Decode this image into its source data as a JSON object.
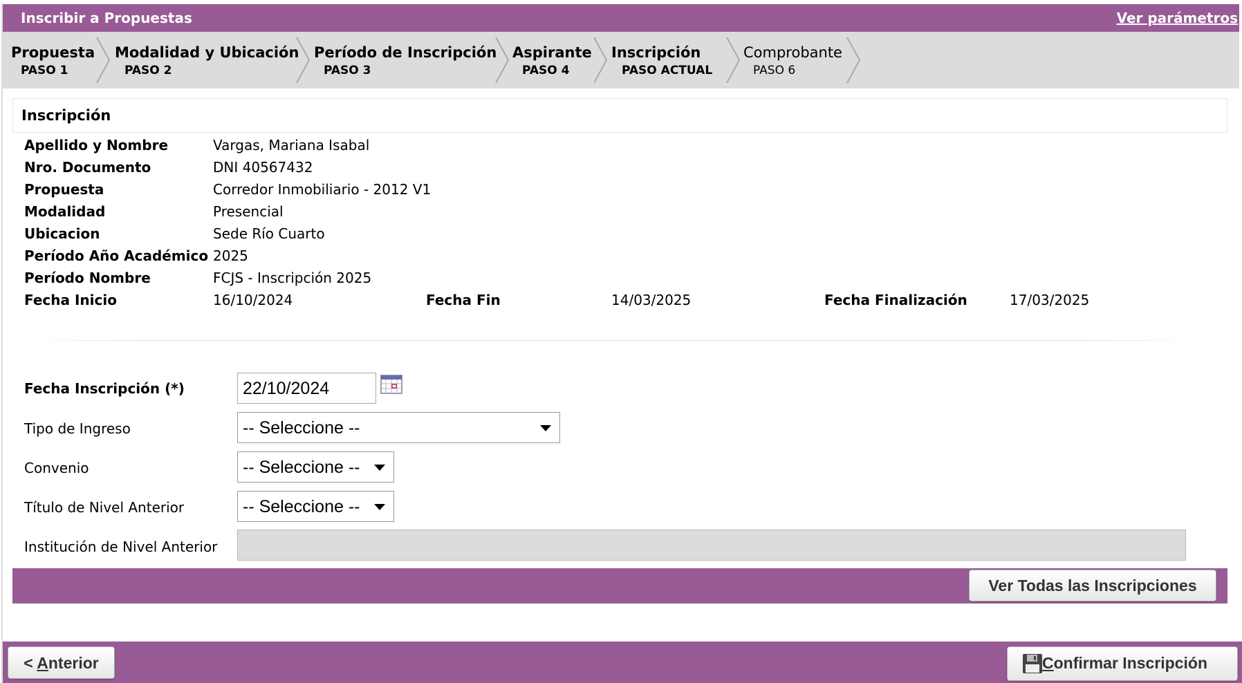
{
  "header": {
    "title": "Inscribir a Propuestas",
    "params_link": "Ver parámetros"
  },
  "steps": [
    {
      "title": "Propuesta",
      "sub": "PASO 1",
      "state": "done"
    },
    {
      "title": "Modalidad y Ubicación",
      "sub": "PASO 2",
      "state": "done"
    },
    {
      "title": "Período de Inscripción",
      "sub": "PASO 3",
      "state": "done"
    },
    {
      "title": "Aspirante",
      "sub": "PASO 4",
      "state": "done"
    },
    {
      "title": "Inscripción",
      "sub": "PASO ACTUAL",
      "state": "current"
    },
    {
      "title": "Comprobante",
      "sub": "PASO 6",
      "state": "pending"
    }
  ],
  "panel": {
    "title": "Inscripción"
  },
  "info": {
    "apellido_label": "Apellido y Nombre",
    "apellido_value": "Vargas, Mariana Isabal",
    "documento_label": "Nro. Documento",
    "documento_value": "DNI 40567432",
    "propuesta_label": "Propuesta",
    "propuesta_value": "Corredor Inmobiliario - 2012 V1",
    "modalidad_label": "Modalidad",
    "modalidad_value": "Presencial",
    "ubicacion_label": "Ubicacion",
    "ubicacion_value": "Sede Río Cuarto",
    "anio_label": "Período Año Académico",
    "anio_value": "2025",
    "periodo_label": "Período Nombre",
    "periodo_value": "FCJS - Inscripción 2025",
    "fecha_inicio_label": "Fecha Inicio",
    "fecha_inicio_value": "16/10/2024",
    "fecha_fin_label": "Fecha Fin",
    "fecha_fin_value": "14/03/2025",
    "fecha_finalizacion_label": "Fecha Finalización",
    "fecha_finalizacion_value": "17/03/2025"
  },
  "form": {
    "fecha_inscripcion_label": "Fecha Inscripción (*)",
    "fecha_inscripcion_value": "22/10/2024",
    "tipo_ingreso_label": "Tipo de Ingreso",
    "tipo_ingreso_value": "-- Seleccione --",
    "convenio_label": "Convenio",
    "convenio_value": "-- Seleccione --",
    "titulo_label": "Título de Nivel Anterior",
    "titulo_value": "-- Seleccione --",
    "institucion_label": "Institución de Nivel Anterior",
    "institucion_value": ""
  },
  "buttons": {
    "ver_todas": "Ver Todas las Inscripciones",
    "anterior_prefix": "< ",
    "anterior_accel": "A",
    "anterior_rest": "nterior",
    "confirmar_accel": "C",
    "confirmar_rest": "onfirmar Inscripción"
  },
  "colors": {
    "accent": "#985b96",
    "steps_bg": "#dcdcdc"
  }
}
